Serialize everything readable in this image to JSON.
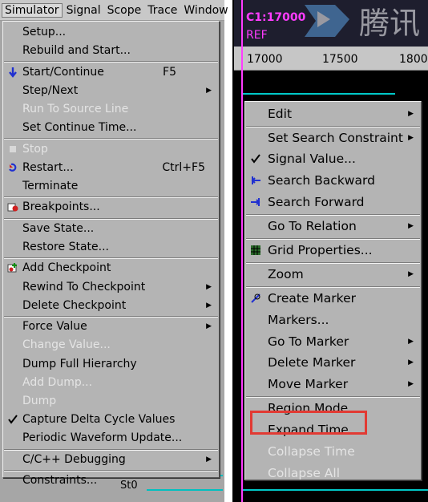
{
  "menubar": [
    {
      "label": "Simulator",
      "active": true
    },
    {
      "label": "Signal"
    },
    {
      "label": "Scope"
    },
    {
      "label": "Trace"
    },
    {
      "label": "Window"
    }
  ],
  "simulator_menu": [
    {
      "label": "Setup..."
    },
    {
      "label": "Rebuild and Start..."
    },
    {
      "sep": true
    },
    {
      "label": "Start/Continue",
      "accel": "F5",
      "icon": "arrow-down-icon"
    },
    {
      "label": "Step/Next",
      "submenu": true
    },
    {
      "label": "Run To Source Line",
      "disabled": true
    },
    {
      "label": "Set Continue Time..."
    },
    {
      "sep": true
    },
    {
      "label": "Stop",
      "disabled": true,
      "icon": "stop-icon"
    },
    {
      "label": "Restart...",
      "accel": "Ctrl+F5",
      "icon": "restart-icon"
    },
    {
      "label": "Terminate"
    },
    {
      "sep": true
    },
    {
      "label": "Breakpoints...",
      "icon": "breakpoint-icon"
    },
    {
      "sep": true
    },
    {
      "label": "Save State..."
    },
    {
      "label": "Restore State..."
    },
    {
      "sep": true
    },
    {
      "label": "Add Checkpoint",
      "icon": "checkpoint-icon"
    },
    {
      "label": "Rewind To Checkpoint",
      "submenu": true
    },
    {
      "label": "Delete Checkpoint",
      "submenu": true
    },
    {
      "sep": true
    },
    {
      "label": "Force Value",
      "submenu": true
    },
    {
      "label": "Change Value...",
      "disabled": true
    },
    {
      "label": "Dump Full Hierarchy"
    },
    {
      "label": "Add Dump...",
      "disabled": true
    },
    {
      "label": "Dump",
      "disabled": true
    },
    {
      "label": "Capture Delta Cycle Values",
      "checked": true
    },
    {
      "label": "Periodic Waveform Update..."
    },
    {
      "sep": true
    },
    {
      "label": "C/C++ Debugging",
      "submenu": true
    },
    {
      "sep": true
    },
    {
      "label": "Constraints..."
    }
  ],
  "context_menu": [
    {
      "label": "Edit",
      "submenu": true
    },
    {
      "sep": true
    },
    {
      "label": "Set Search Constraint",
      "submenu": true
    },
    {
      "label": "Signal Value...",
      "checked": true
    },
    {
      "label": "Search Backward",
      "icon": "search-backward-icon"
    },
    {
      "label": "Search Forward",
      "icon": "search-forward-icon"
    },
    {
      "sep": true
    },
    {
      "label": "Go To Relation",
      "submenu": true
    },
    {
      "sep": true
    },
    {
      "label": "Grid Properties...",
      "icon": "grid-icon"
    },
    {
      "sep": true
    },
    {
      "label": "Zoom",
      "submenu": true
    },
    {
      "sep": true
    },
    {
      "label": "Create Marker",
      "icon": "marker-icon"
    },
    {
      "label": "Markers..."
    },
    {
      "label": "Go To Marker",
      "submenu": true
    },
    {
      "label": "Delete Marker",
      "submenu": true
    },
    {
      "label": "Move Marker",
      "submenu": true
    },
    {
      "sep": true
    },
    {
      "label": "Region Mode"
    },
    {
      "label": "Expand Time",
      "highlighted": true
    },
    {
      "label": "Collapse Time",
      "disabled": true
    },
    {
      "label": "Collapse All",
      "disabled": true
    }
  ],
  "waveform": {
    "cursor_label": "C1:17000",
    "ref_label": "REF",
    "ruler_ticks": [
      "17000",
      "17500",
      "1800"
    ],
    "signal_value": "St0"
  },
  "watermark": {
    "text": "腾讯"
  },
  "colors": {
    "menu_bg": "#b4b4b4",
    "highlight_box": "#e23a33",
    "cursor": "#ff3cff",
    "signal": "#00c8c8"
  }
}
